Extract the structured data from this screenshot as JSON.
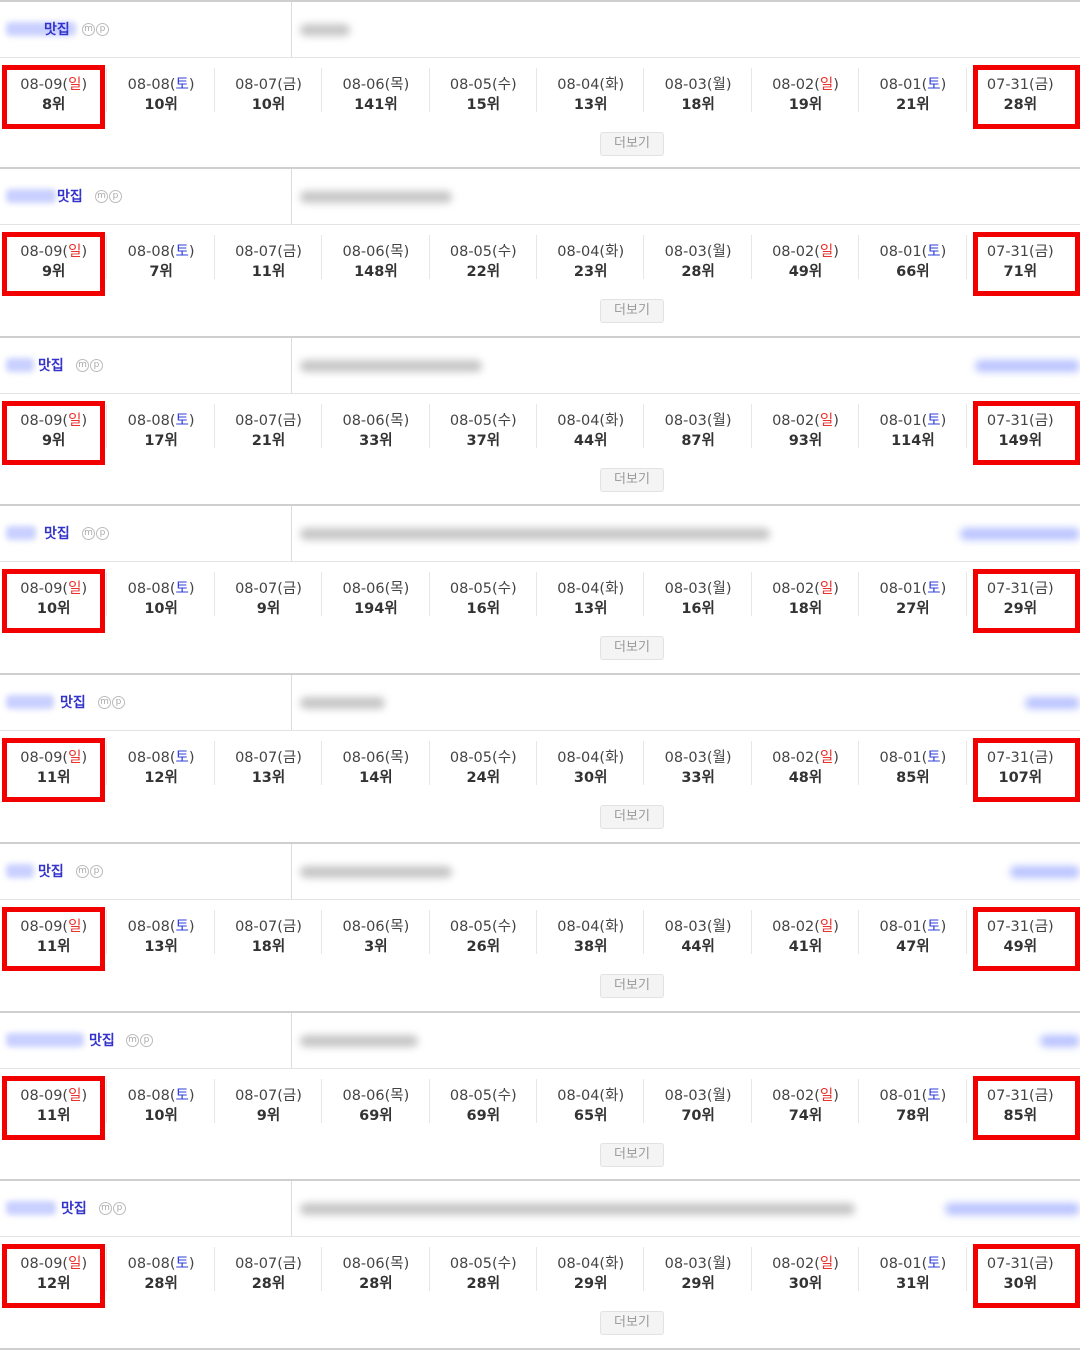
{
  "common": {
    "keyword_suffix": "맛집",
    "badge_m": "m",
    "badge_p": "p",
    "more_label": "더보기",
    "dates": [
      {
        "date": "08-09",
        "day": "일",
        "type": "sun"
      },
      {
        "date": "08-08",
        "day": "토",
        "type": "sat"
      },
      {
        "date": "08-07",
        "day": "금",
        "type": "wk"
      },
      {
        "date": "08-06",
        "day": "목",
        "type": "wk"
      },
      {
        "date": "08-05",
        "day": "수",
        "type": "wk"
      },
      {
        "date": "08-04",
        "day": "화",
        "type": "wk"
      },
      {
        "date": "08-03",
        "day": "월",
        "type": "wk"
      },
      {
        "date": "08-02",
        "day": "일",
        "type": "sun"
      },
      {
        "date": "08-01",
        "day": "토",
        "type": "sat"
      },
      {
        "date": "07-31",
        "day": "금",
        "type": "wk"
      }
    ]
  },
  "colors": {
    "highlight": "#f20000",
    "keyword": "#3333cc",
    "sunday": "#e8322b",
    "saturday": "#2f3fd8"
  },
  "blocks": [
    {
      "ranks": [
        "8위",
        "10위",
        "10위",
        "141위",
        "15위",
        "13위",
        "18위",
        "19위",
        "21위",
        "28위"
      ]
    },
    {
      "ranks": [
        "9위",
        "7위",
        "11위",
        "148위",
        "22위",
        "23위",
        "28위",
        "49위",
        "66위",
        "71위"
      ]
    },
    {
      "ranks": [
        "9위",
        "17위",
        "21위",
        "33위",
        "37위",
        "44위",
        "87위",
        "93위",
        "114위",
        "149위"
      ]
    },
    {
      "ranks": [
        "10위",
        "10위",
        "9위",
        "194위",
        "16위",
        "13위",
        "16위",
        "18위",
        "27위",
        "29위"
      ]
    },
    {
      "ranks": [
        "11위",
        "12위",
        "13위",
        "14위",
        "24위",
        "30위",
        "33위",
        "48위",
        "85위",
        "107위"
      ]
    },
    {
      "ranks": [
        "11위",
        "13위",
        "18위",
        "3위",
        "26위",
        "38위",
        "44위",
        "41위",
        "47위",
        "49위"
      ]
    },
    {
      "ranks": [
        "11위",
        "10위",
        "9위",
        "69위",
        "69위",
        "65위",
        "70위",
        "74위",
        "78위",
        "85위"
      ]
    },
    {
      "ranks": [
        "12위",
        "28위",
        "28위",
        "28위",
        "28위",
        "29위",
        "29위",
        "30위",
        "31위",
        "30위"
      ]
    }
  ]
}
